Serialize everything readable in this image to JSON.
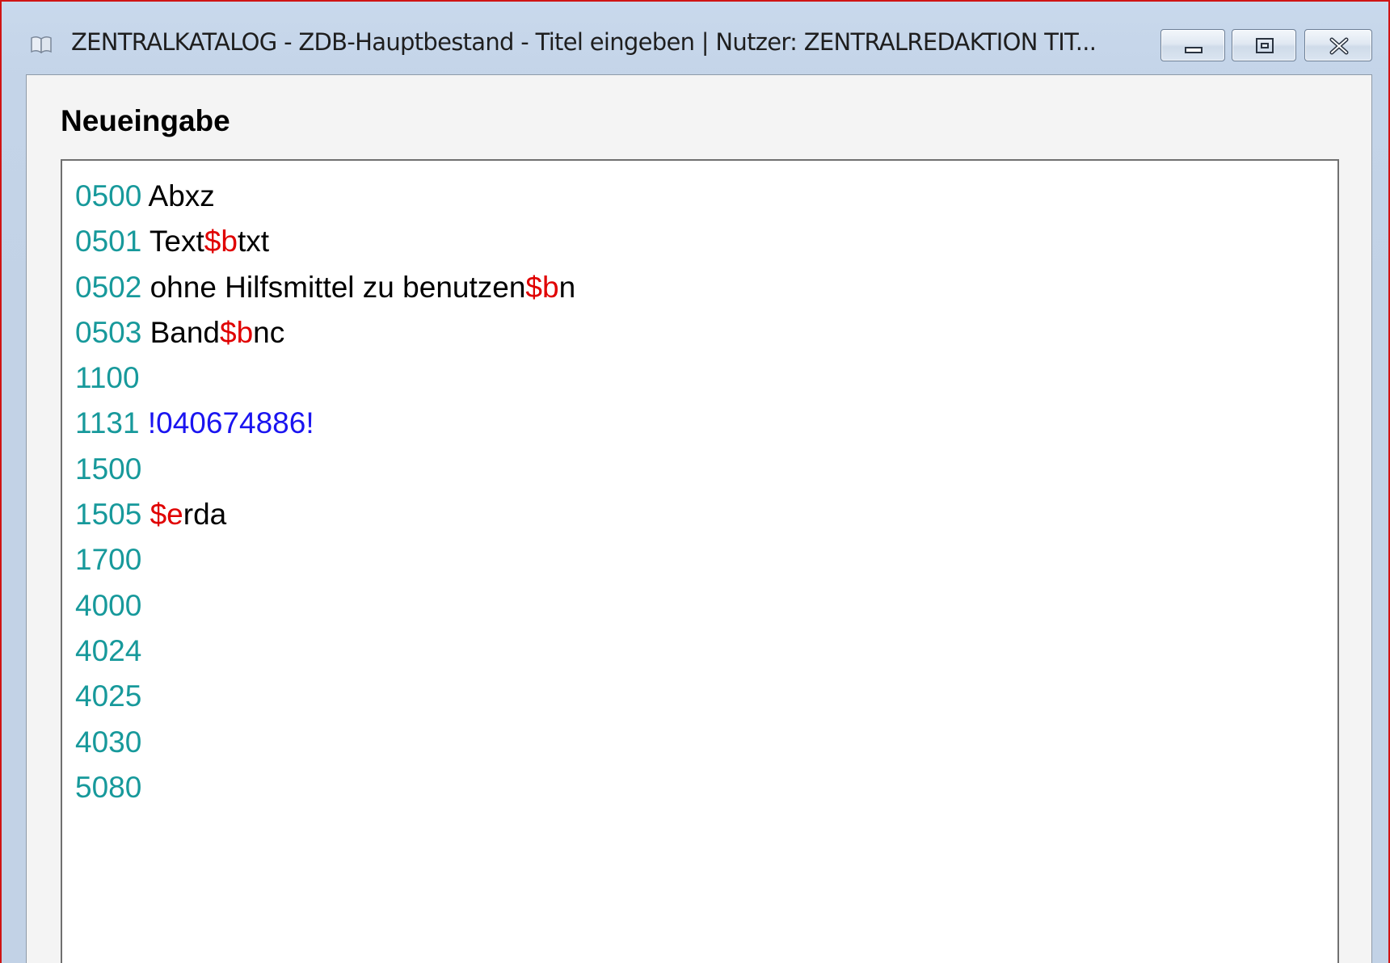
{
  "window": {
    "title": "ZENTRALKATALOG - ZDB-Hauptbestand - Titel eingeben | Nutzer: ZENTRALREDAKTION TIT...",
    "controls": [
      "minimize-icon",
      "restore-icon",
      "close-icon"
    ]
  },
  "editor": {
    "heading": "Neueingabe",
    "lines": [
      {
        "tag": "0500",
        "segments": [
          {
            "type": "text",
            "value": " Abxz"
          }
        ]
      },
      {
        "tag": "0501",
        "segments": [
          {
            "type": "text",
            "value": " Text"
          },
          {
            "type": "sub",
            "value": "$b"
          },
          {
            "type": "text",
            "value": "txt"
          }
        ]
      },
      {
        "tag": "0502",
        "segments": [
          {
            "type": "text",
            "value": " ohne Hilfsmittel zu benutzen"
          },
          {
            "type": "sub",
            "value": "$b"
          },
          {
            "type": "text",
            "value": "n"
          }
        ]
      },
      {
        "tag": "0503",
        "segments": [
          {
            "type": "text",
            "value": " Band"
          },
          {
            "type": "sub",
            "value": "$b"
          },
          {
            "type": "text",
            "value": "nc"
          }
        ]
      },
      {
        "tag": "1100",
        "segments": []
      },
      {
        "tag": "1131",
        "segments": [
          {
            "type": "text",
            "value": " "
          },
          {
            "type": "link",
            "value": "!040674886!"
          }
        ]
      },
      {
        "tag": "1500",
        "segments": []
      },
      {
        "tag": "1505",
        "segments": [
          {
            "type": "text",
            "value": " "
          },
          {
            "type": "sub",
            "value": "$e"
          },
          {
            "type": "text",
            "value": "rda"
          }
        ]
      },
      {
        "tag": "1700",
        "segments": []
      },
      {
        "tag": "4000",
        "segments": []
      },
      {
        "tag": "4024",
        "segments": []
      },
      {
        "tag": "4025",
        "segments": []
      },
      {
        "tag": "4030",
        "segments": []
      },
      {
        "tag": "5080",
        "segments": []
      }
    ]
  },
  "colors": {
    "tag": "#17999b",
    "text": "#000000",
    "subfield": "#e00000",
    "link": "#1a14f0",
    "window_border": "#d01414"
  }
}
